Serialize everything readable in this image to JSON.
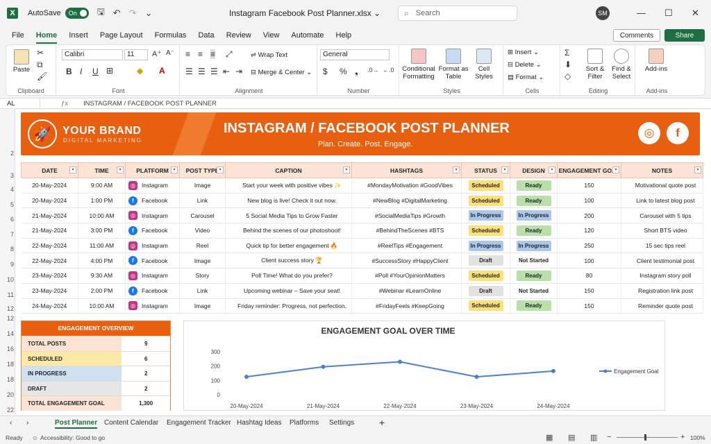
{
  "titlebar": {
    "autosave_label": "AutoSave",
    "autosave_state": "On",
    "doc_title": "Instagram Facebook Post Planner.xlsx",
    "search_placeholder": "Search",
    "user_initials": "SM"
  },
  "menu": {
    "items": [
      "File",
      "Home",
      "Insert",
      "Page Layout",
      "Formulas",
      "Data",
      "Review",
      "View",
      "Automate",
      "Help"
    ],
    "comments": "Comments",
    "share": "Share"
  },
  "ribbon": {
    "clipboard": {
      "paste": "Paste",
      "label": "Clipboard"
    },
    "font": {
      "name": "Calibri",
      "size": "11",
      "label": "Font"
    },
    "alignment": {
      "wrap": "Wrap Text",
      "merge": "Merge & Center",
      "label": "Alignment"
    },
    "number": {
      "format": "General",
      "label": "Number"
    },
    "styles": {
      "cond1": "Conditional",
      "cond2": "Formatting",
      "fmt1": "Format as",
      "fmt2": "Table",
      "cell1": "Cell",
      "cell2": "Styles",
      "label": "Styles"
    },
    "cells": {
      "insert": "Insert",
      "delete": "Delete",
      "format": "Format",
      "label": "Cells"
    },
    "editing": {
      "sort1": "Sort &",
      "sort2": "Filter",
      "find1": "Find &",
      "find2": "Select",
      "label": "Editing"
    },
    "addins": {
      "btn": "Add-ins",
      "label": "Add-ins"
    }
  },
  "formula": {
    "cell_ref": "AL",
    "content": "INSTAGRAM / FACEBOOK POST PLANNER"
  },
  "banner": {
    "brand": "YOUR BRAND",
    "brand_sub": "DIGITAL MARKETING",
    "title": "INSTAGRAM / FACEBOOK POST PLANNER",
    "subtitle": "Plan. Create. Post. Engage."
  },
  "table": {
    "headers": [
      "DATE",
      "TIME",
      "PLATFORM",
      "POST TYPE",
      "CAPTION",
      "HASHTAGS",
      "STATUS",
      "DESIGN",
      "ENGAGEMENT GOAL",
      "NOTES"
    ],
    "rows": [
      {
        "date": "20-May-2024",
        "time": "9:00 AM",
        "platform": "Instagram",
        "type": "Image",
        "caption": "Start your week with positive vibes ✨",
        "hashtags": "#MondayMotivation #GoodVibes",
        "status": "Scheduled",
        "design": "Ready",
        "goal": "150",
        "notes": "Motivational quote post"
      },
      {
        "date": "20-May-2024",
        "time": "1:00 PM",
        "platform": "Facebook",
        "type": "Link",
        "caption": "New blog is live! Check it out now.",
        "hashtags": "#NewBlog #DigitalMarketing",
        "status": "Scheduled",
        "design": "Ready",
        "goal": "100",
        "notes": "Link to latest blog post"
      },
      {
        "date": "21-May-2024",
        "time": "10:00 AM",
        "platform": "Instagram",
        "type": "Carousel",
        "caption": "5 Social Media Tips to Grow Faster",
        "hashtags": "#SocialMediaTips #Growth",
        "status": "In Progress",
        "design": "In Progress",
        "goal": "200",
        "notes": "Carousel with 5 tips"
      },
      {
        "date": "21-May-2024",
        "time": "3:00 PM",
        "platform": "Facebook",
        "type": "Video",
        "caption": "Behind the scenes of our photoshoot!",
        "hashtags": "#BehindTheScenes #BTS",
        "status": "Scheduled",
        "design": "Ready",
        "goal": "120",
        "notes": "Short BTS video"
      },
      {
        "date": "22-May-2024",
        "time": "11:00 AM",
        "platform": "Instagram",
        "type": "Reel",
        "caption": "Quick tip for better engagement 🔥",
        "hashtags": "#ReelTips #Engagement",
        "status": "In Progress",
        "design": "In Progress",
        "goal": "250",
        "notes": "15 sec tips reel"
      },
      {
        "date": "22-May-2024",
        "time": "4:00 PM",
        "platform": "Facebook",
        "type": "Image",
        "caption": "Client success story 🏆",
        "hashtags": "#SuccessStory #HappyClient",
        "status": "Draft",
        "design": "Not Started",
        "goal": "100",
        "notes": "Client testimonial post"
      },
      {
        "date": "23-May-2024",
        "time": "9:30 AM",
        "platform": "Instagram",
        "type": "Story",
        "caption": "Poll Time! What do you prefer?",
        "hashtags": "#Poll #YourOpinionMatters",
        "status": "Scheduled",
        "design": "Ready",
        "goal": "80",
        "notes": "Instagram story poll"
      },
      {
        "date": "23-May-2024",
        "time": "2:00 PM",
        "platform": "Facebook",
        "type": "Link",
        "caption": "Upcoming webinar – Save your seat!",
        "hashtags": "#Webinar #LearnOnline",
        "status": "Draft",
        "design": "Not Started",
        "goal": "150",
        "notes": "Registration link post"
      },
      {
        "date": "24-May-2024",
        "time": "10:00 AM",
        "platform": "Instagram",
        "type": "Image",
        "caption": "Friday reminder: Progress, not perfection.",
        "hashtags": "#FridayFeels #KeepGoing",
        "status": "Scheduled",
        "design": "Ready",
        "goal": "150",
        "notes": "Reminder quote post"
      }
    ]
  },
  "overview": {
    "title": "ENGAGEMENT OVERVIEW",
    "rows": [
      {
        "label": "TOTAL POSTS",
        "value": "9",
        "color": "#fbe4d6"
      },
      {
        "label": "SCHEDULED",
        "value": "6",
        "color": "#fde9a6"
      },
      {
        "label": "IN PROGRESS",
        "value": "2",
        "color": "#cfe0f0"
      },
      {
        "label": "DRAFT",
        "value": "2",
        "color": "#e6e6e6"
      },
      {
        "label": "TOTAL ENGAGEMENT GOAL",
        "value": "1,300",
        "color": "#fbe4d6"
      }
    ]
  },
  "chart_data": {
    "type": "line",
    "title": "ENGAGEMENT GOAL OVER TIME",
    "categories": [
      "20-May-2024",
      "21-May-2024",
      "22-May-2024",
      "23-May-2024",
      "24-May-2024"
    ],
    "series": [
      {
        "name": "Engagement Goal",
        "values": [
          125,
          195,
          230,
          125,
          165
        ]
      }
    ],
    "ylim": [
      0,
      300
    ],
    "yticks": [
      0,
      100,
      200,
      300
    ],
    "legend": "right",
    "color": "#4a7fd4"
  },
  "tabs": [
    "Post Planner",
    "Content Calendar",
    "Engagement Tracker",
    "Hashtag Ideas",
    "Platforms",
    "Settings"
  ],
  "status": {
    "ready": "Ready",
    "accessibility": "Accessibility: Good to go",
    "zoom": "100%"
  },
  "badge_colors": {
    "Scheduled": "#fde07a",
    "In Progress": "#a9c8ec",
    "Draft": "#e2e2e2",
    "Ready": "#b8e0a8",
    "Not Started": "#ffffff"
  }
}
